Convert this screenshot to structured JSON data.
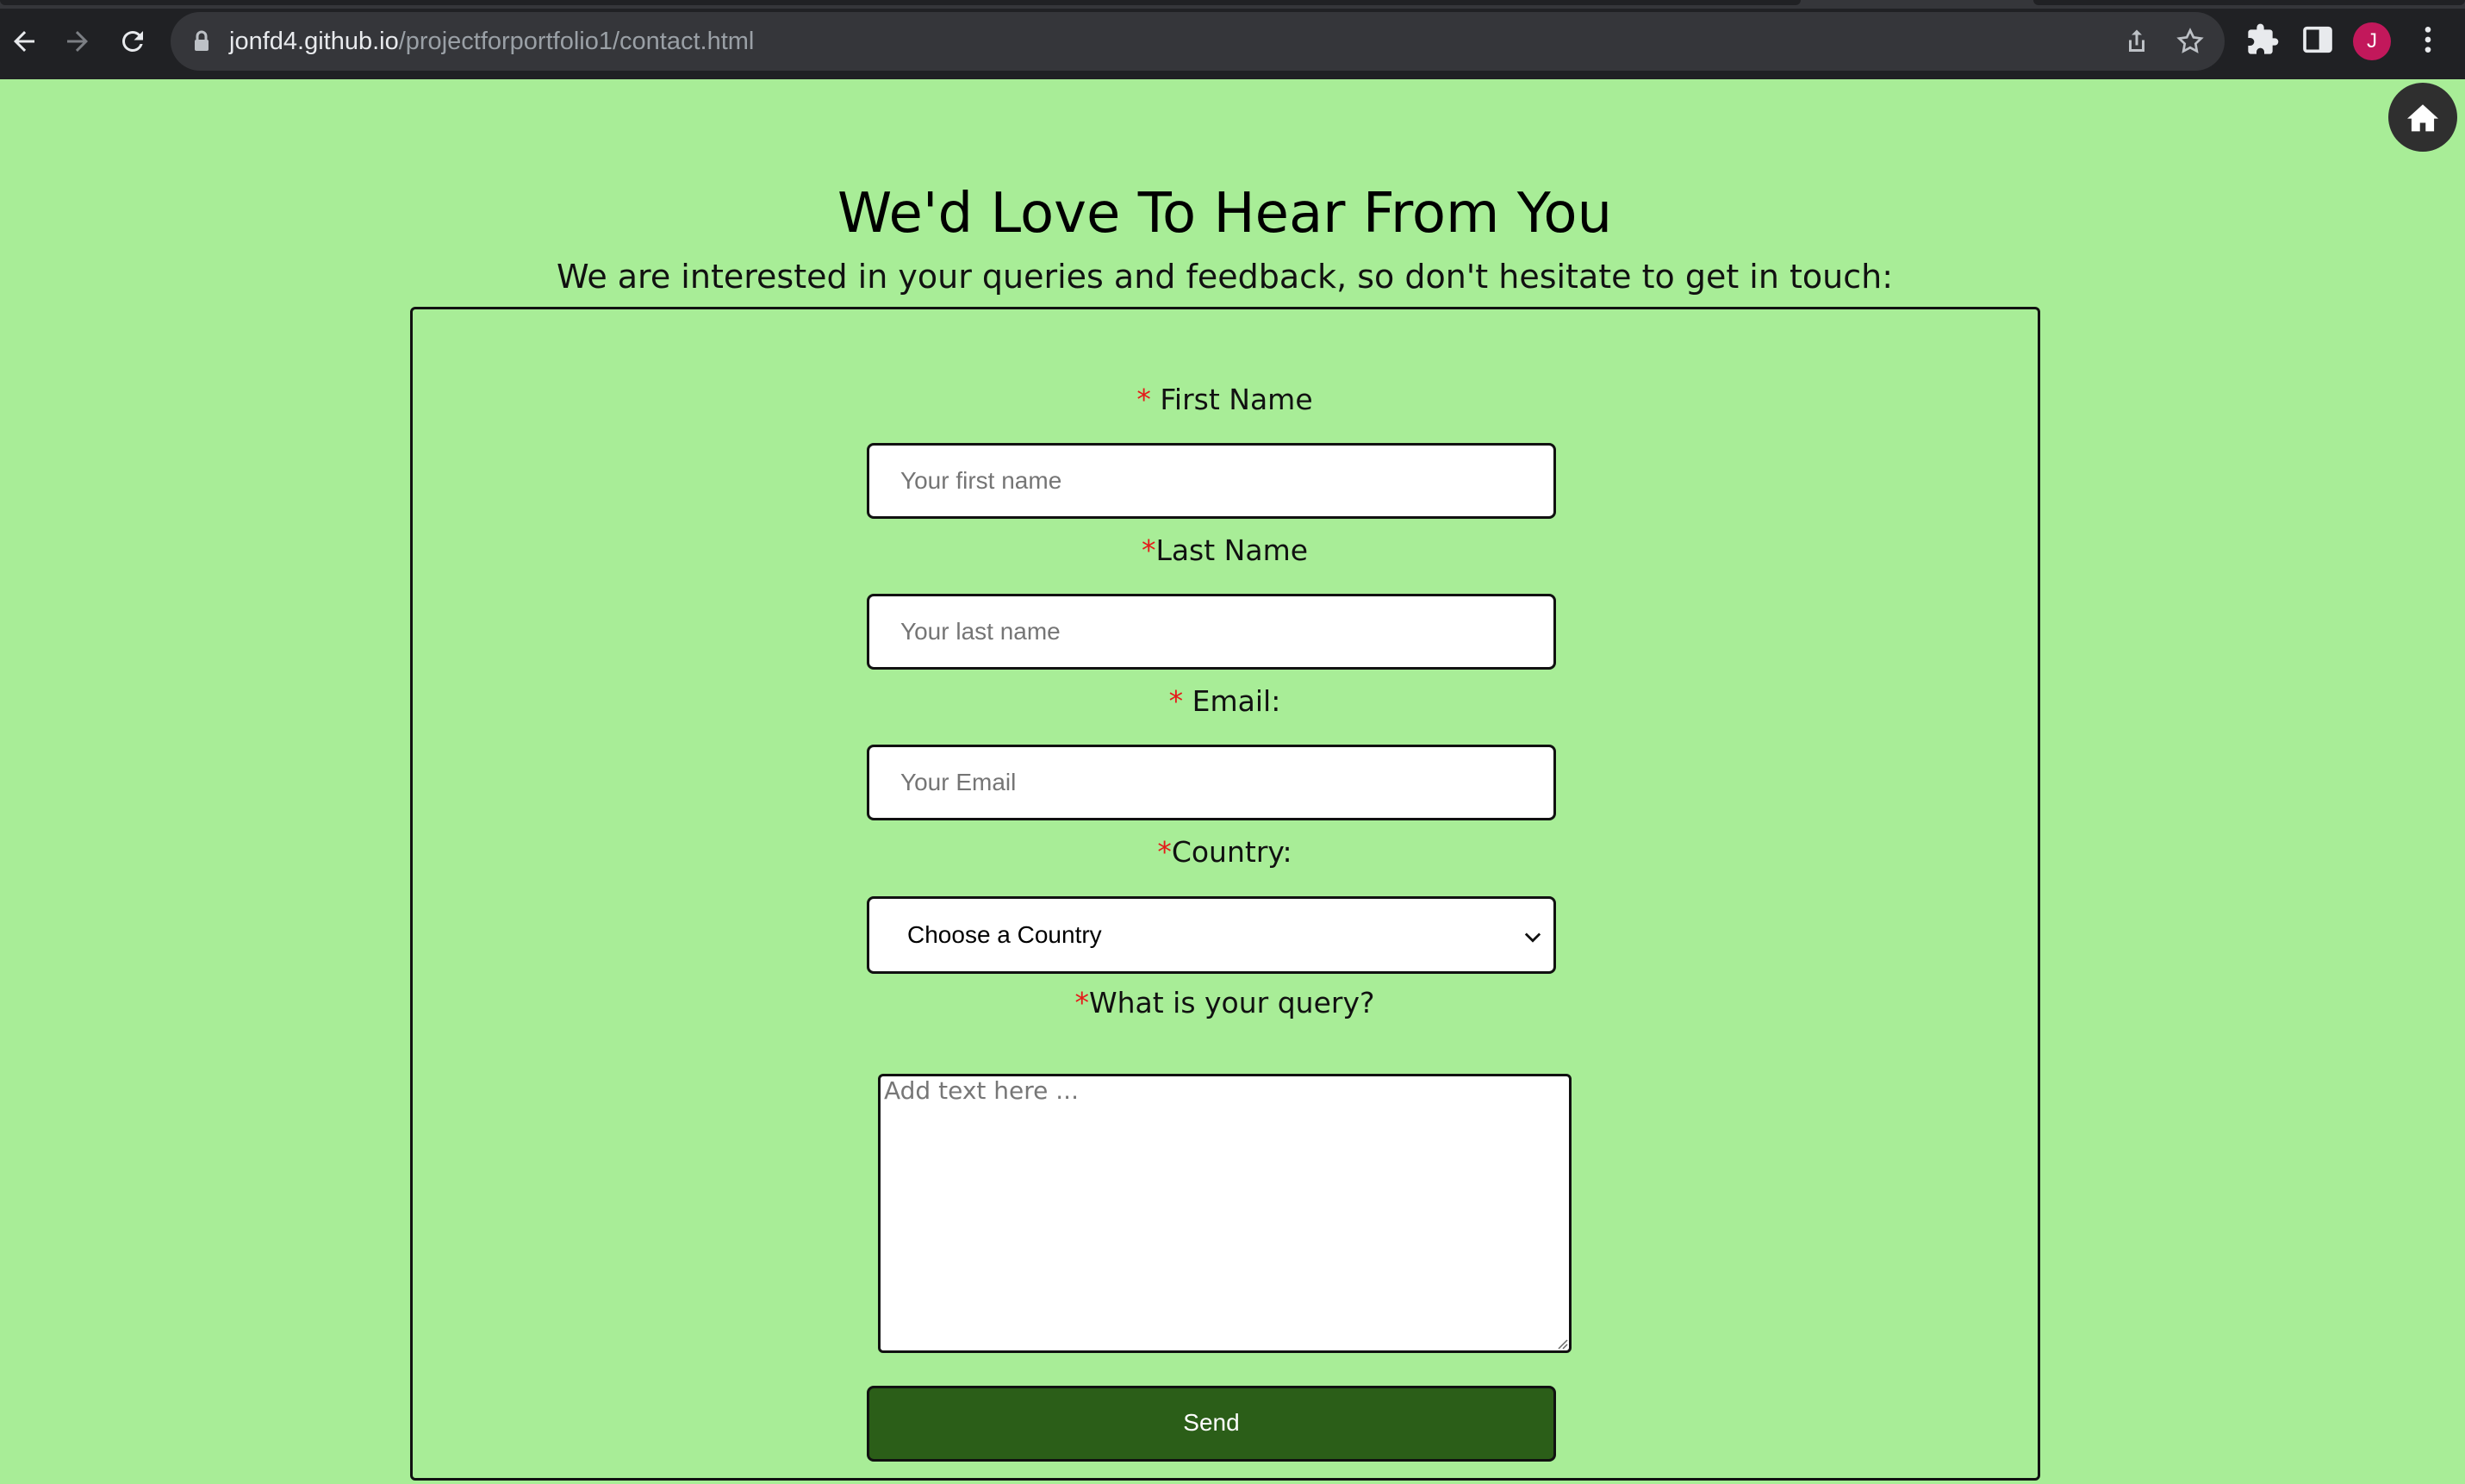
{
  "browser": {
    "url_host": "jonfd4.github.io",
    "url_path": "/projectforportfolio1/contact.html",
    "profile_initial": "J",
    "icons": [
      "back-icon",
      "forward-icon",
      "reload-icon",
      "lock-icon",
      "share-icon",
      "star-icon",
      "extensions-icon",
      "side-panel-icon",
      "menu-icon"
    ]
  },
  "page": {
    "home_icon": "home-icon",
    "title": "We'd Love To Hear From You",
    "subtitle": "We are interested in your queries and feedback, so don't hesitate to get in touch:"
  },
  "form": {
    "required_mark": "*",
    "first_name": {
      "label": " First Name",
      "placeholder": "Your first name",
      "value": ""
    },
    "last_name": {
      "label": "Last Name",
      "placeholder": "Your last name",
      "value": ""
    },
    "email": {
      "label": " Email:",
      "placeholder": "Your Email",
      "value": ""
    },
    "country": {
      "label": "Country:",
      "selected": "Choose a Country"
    },
    "query": {
      "label": "What is your query?",
      "placeholder": "Add text here ..."
    },
    "submit_label": "Send"
  },
  "colors": {
    "page_background": "#a8ed97",
    "send_button": "#2b5e18",
    "required_mark": "#e51a1a",
    "avatar": "#c2185b"
  }
}
